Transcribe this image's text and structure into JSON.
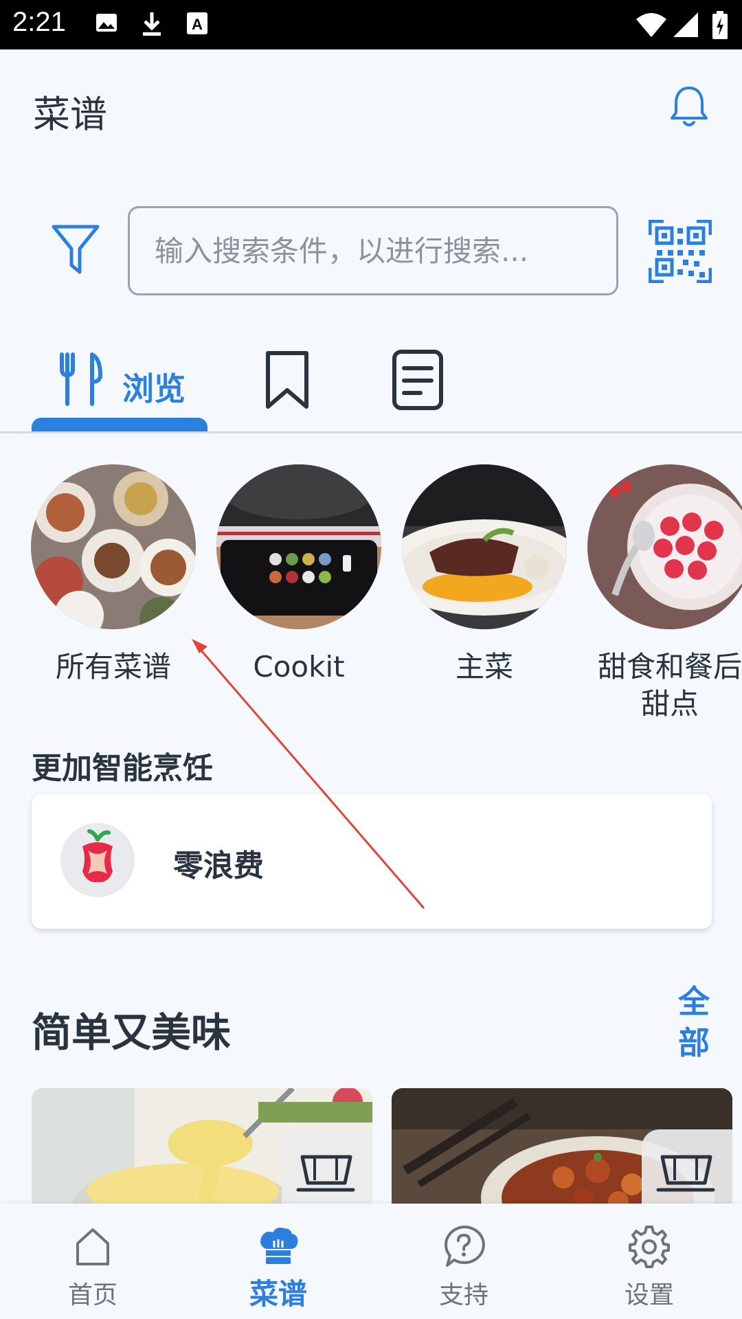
{
  "status_bar": {
    "time": "2:21"
  },
  "header": {
    "title": "菜谱"
  },
  "search": {
    "placeholder": "输入搜索条件，以进行搜索..."
  },
  "tabs": {
    "browse_label": "浏览"
  },
  "categories": [
    {
      "label": "所有菜谱"
    },
    {
      "label": "Cookit"
    },
    {
      "label": "主菜"
    },
    {
      "label": "甜食和餐后甜点"
    }
  ],
  "smart_section": {
    "title": "更加智能烹饪",
    "card_label": "零浪费"
  },
  "easy_section": {
    "title": "简单又美味",
    "see_all": "全部"
  },
  "bottom_nav": [
    {
      "label": "首页",
      "icon": "home-icon"
    },
    {
      "label": "菜谱",
      "icon": "chef-hat-icon"
    },
    {
      "label": "支持",
      "icon": "help-icon"
    },
    {
      "label": "设置",
      "icon": "gear-icon"
    }
  ],
  "colors": {
    "accent": "#2A7FDF",
    "text": "#2A3440",
    "muted": "#6B737C",
    "annotation": "#E0433A"
  }
}
